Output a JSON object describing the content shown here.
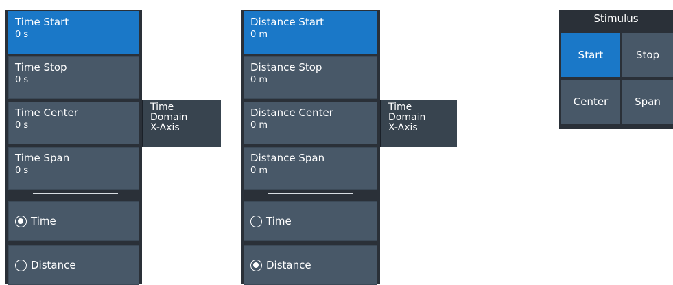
{
  "time_panel": {
    "softkeys": [
      {
        "title": "Time Start",
        "value": "0 s"
      },
      {
        "title": "Time Stop",
        "value": "0 s"
      },
      {
        "title": "Time Center",
        "value": "0 s"
      },
      {
        "title": "Time Span",
        "value": "0 s"
      }
    ],
    "radios": [
      {
        "label": "Time",
        "checked": true
      },
      {
        "label": "Distance",
        "checked": false
      }
    ],
    "group_label": [
      "Time",
      "Domain",
      "X-Axis"
    ]
  },
  "distance_panel": {
    "softkeys": [
      {
        "title": "Distance Start",
        "value": "0 m"
      },
      {
        "title": "Distance Stop",
        "value": "0 m"
      },
      {
        "title": "Distance Center",
        "value": "0 m"
      },
      {
        "title": "Distance Span",
        "value": "0 m"
      }
    ],
    "radios": [
      {
        "label": "Time",
        "checked": false
      },
      {
        "label": "Distance",
        "checked": true
      }
    ],
    "group_label": [
      "Time",
      "Domain",
      "X-Axis"
    ]
  },
  "stimulus": {
    "title": "Stimulus",
    "buttons": {
      "start": "Start",
      "stop": "Stop",
      "center": "Center",
      "span": "Span"
    }
  },
  "colors": {
    "active": "#1a78c8",
    "key": "#485868",
    "panel": "#2a3038"
  }
}
